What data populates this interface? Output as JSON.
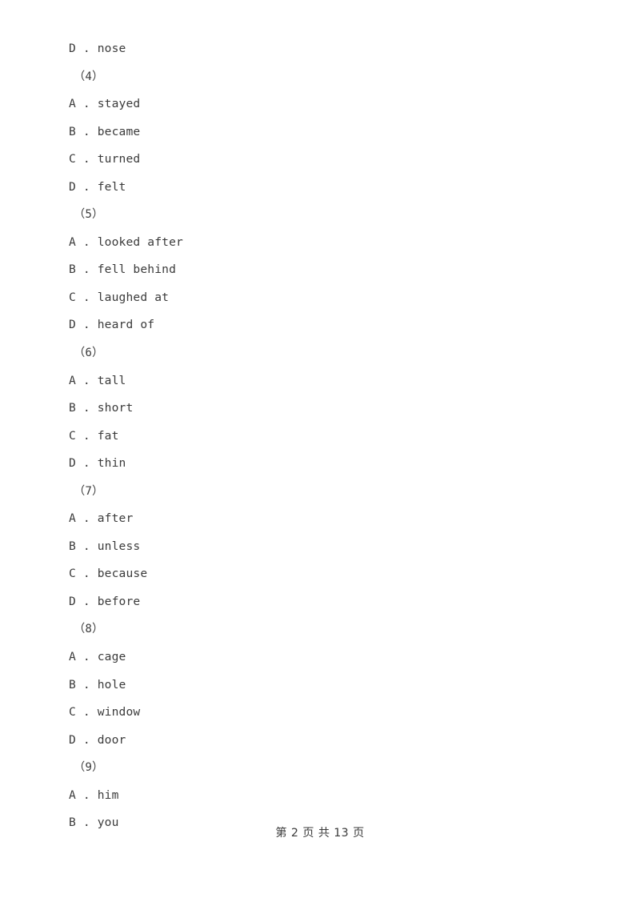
{
  "document": {
    "page_background": "#ffffff",
    "text_color": "#3b3b3b"
  },
  "body_lines": [
    {
      "kind": "option",
      "text": "D . nose"
    },
    {
      "kind": "qnum",
      "text": "（4）"
    },
    {
      "kind": "option",
      "text": "A . stayed"
    },
    {
      "kind": "option",
      "text": "B . became"
    },
    {
      "kind": "option",
      "text": "C . turned"
    },
    {
      "kind": "option",
      "text": "D . felt"
    },
    {
      "kind": "qnum",
      "text": "（5）"
    },
    {
      "kind": "option",
      "text": "A . looked after"
    },
    {
      "kind": "option",
      "text": "B . fell behind"
    },
    {
      "kind": "option",
      "text": "C . laughed at"
    },
    {
      "kind": "option",
      "text": "D . heard of"
    },
    {
      "kind": "qnum",
      "text": "（6）"
    },
    {
      "kind": "option",
      "text": "A . tall"
    },
    {
      "kind": "option",
      "text": "B . short"
    },
    {
      "kind": "option",
      "text": "C . fat"
    },
    {
      "kind": "option",
      "text": "D . thin"
    },
    {
      "kind": "qnum",
      "text": "（7）"
    },
    {
      "kind": "option",
      "text": "A . after"
    },
    {
      "kind": "option",
      "text": "B . unless"
    },
    {
      "kind": "option",
      "text": "C . because"
    },
    {
      "kind": "option",
      "text": "D . before"
    },
    {
      "kind": "qnum",
      "text": "（8）"
    },
    {
      "kind": "option",
      "text": "A . cage"
    },
    {
      "kind": "option",
      "text": "B . hole"
    },
    {
      "kind": "option",
      "text": "C . window"
    },
    {
      "kind": "option",
      "text": "D . door"
    },
    {
      "kind": "qnum",
      "text": "（9）"
    },
    {
      "kind": "option",
      "text": "A . him"
    },
    {
      "kind": "option",
      "text": "B . you"
    }
  ],
  "footer": {
    "text": "第 2 页 共 13 页",
    "current_page": "2",
    "total_pages": "13"
  }
}
